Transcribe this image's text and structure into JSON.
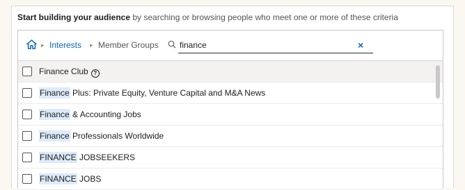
{
  "intro": {
    "bold": "Start building your audience",
    "rest": " by searching or browsing people who meet one or more of these criteria"
  },
  "breadcrumb": {
    "home_icon": "home-icon",
    "interests": "Interests",
    "member_groups": "Member Groups"
  },
  "search": {
    "value": "finance",
    "clear_symbol": "×"
  },
  "results": [
    {
      "match": "Finance Club",
      "rest": "",
      "help": true
    },
    {
      "match": "Finance",
      "rest": " Plus: Private Equity, Venture Capital and M&A News",
      "help": false
    },
    {
      "match": "Finance",
      "rest": " & Accounting Jobs",
      "help": false
    },
    {
      "match": "Finance",
      "rest": " Professionals Worldwide",
      "help": false
    },
    {
      "match": "FINANCE",
      "rest": " JOBSEEKERS",
      "help": false
    },
    {
      "match": "FINANCE",
      "rest": " JOBS",
      "help": false
    }
  ],
  "colors": {
    "link": "#0a66c2",
    "highlight": "#dcebfa"
  }
}
